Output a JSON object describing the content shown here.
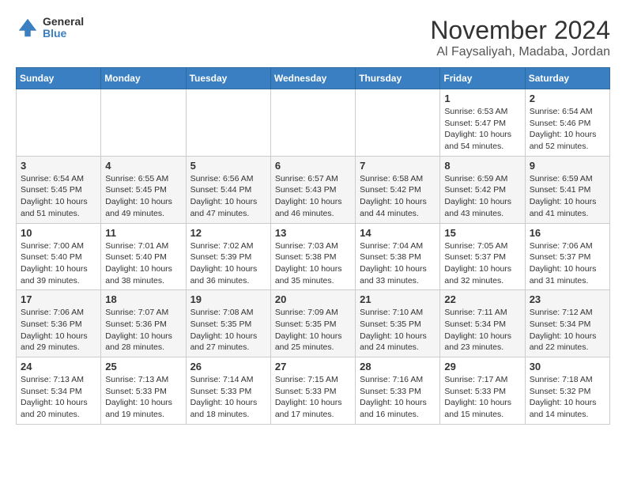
{
  "logo": {
    "general": "General",
    "blue": "Blue"
  },
  "header": {
    "month": "November 2024",
    "location": "Al Faysaliyah, Madaba, Jordan"
  },
  "days_of_week": [
    "Sunday",
    "Monday",
    "Tuesday",
    "Wednesday",
    "Thursday",
    "Friday",
    "Saturday"
  ],
  "weeks": [
    [
      {
        "day": "",
        "info": ""
      },
      {
        "day": "",
        "info": ""
      },
      {
        "day": "",
        "info": ""
      },
      {
        "day": "",
        "info": ""
      },
      {
        "day": "",
        "info": ""
      },
      {
        "day": "1",
        "info": "Sunrise: 6:53 AM\nSunset: 5:47 PM\nDaylight: 10 hours and 54 minutes."
      },
      {
        "day": "2",
        "info": "Sunrise: 6:54 AM\nSunset: 5:46 PM\nDaylight: 10 hours and 52 minutes."
      }
    ],
    [
      {
        "day": "3",
        "info": "Sunrise: 6:54 AM\nSunset: 5:45 PM\nDaylight: 10 hours and 51 minutes."
      },
      {
        "day": "4",
        "info": "Sunrise: 6:55 AM\nSunset: 5:45 PM\nDaylight: 10 hours and 49 minutes."
      },
      {
        "day": "5",
        "info": "Sunrise: 6:56 AM\nSunset: 5:44 PM\nDaylight: 10 hours and 47 minutes."
      },
      {
        "day": "6",
        "info": "Sunrise: 6:57 AM\nSunset: 5:43 PM\nDaylight: 10 hours and 46 minutes."
      },
      {
        "day": "7",
        "info": "Sunrise: 6:58 AM\nSunset: 5:42 PM\nDaylight: 10 hours and 44 minutes."
      },
      {
        "day": "8",
        "info": "Sunrise: 6:59 AM\nSunset: 5:42 PM\nDaylight: 10 hours and 43 minutes."
      },
      {
        "day": "9",
        "info": "Sunrise: 6:59 AM\nSunset: 5:41 PM\nDaylight: 10 hours and 41 minutes."
      }
    ],
    [
      {
        "day": "10",
        "info": "Sunrise: 7:00 AM\nSunset: 5:40 PM\nDaylight: 10 hours and 39 minutes."
      },
      {
        "day": "11",
        "info": "Sunrise: 7:01 AM\nSunset: 5:40 PM\nDaylight: 10 hours and 38 minutes."
      },
      {
        "day": "12",
        "info": "Sunrise: 7:02 AM\nSunset: 5:39 PM\nDaylight: 10 hours and 36 minutes."
      },
      {
        "day": "13",
        "info": "Sunrise: 7:03 AM\nSunset: 5:38 PM\nDaylight: 10 hours and 35 minutes."
      },
      {
        "day": "14",
        "info": "Sunrise: 7:04 AM\nSunset: 5:38 PM\nDaylight: 10 hours and 33 minutes."
      },
      {
        "day": "15",
        "info": "Sunrise: 7:05 AM\nSunset: 5:37 PM\nDaylight: 10 hours and 32 minutes."
      },
      {
        "day": "16",
        "info": "Sunrise: 7:06 AM\nSunset: 5:37 PM\nDaylight: 10 hours and 31 minutes."
      }
    ],
    [
      {
        "day": "17",
        "info": "Sunrise: 7:06 AM\nSunset: 5:36 PM\nDaylight: 10 hours and 29 minutes."
      },
      {
        "day": "18",
        "info": "Sunrise: 7:07 AM\nSunset: 5:36 PM\nDaylight: 10 hours and 28 minutes."
      },
      {
        "day": "19",
        "info": "Sunrise: 7:08 AM\nSunset: 5:35 PM\nDaylight: 10 hours and 27 minutes."
      },
      {
        "day": "20",
        "info": "Sunrise: 7:09 AM\nSunset: 5:35 PM\nDaylight: 10 hours and 25 minutes."
      },
      {
        "day": "21",
        "info": "Sunrise: 7:10 AM\nSunset: 5:35 PM\nDaylight: 10 hours and 24 minutes."
      },
      {
        "day": "22",
        "info": "Sunrise: 7:11 AM\nSunset: 5:34 PM\nDaylight: 10 hours and 23 minutes."
      },
      {
        "day": "23",
        "info": "Sunrise: 7:12 AM\nSunset: 5:34 PM\nDaylight: 10 hours and 22 minutes."
      }
    ],
    [
      {
        "day": "24",
        "info": "Sunrise: 7:13 AM\nSunset: 5:34 PM\nDaylight: 10 hours and 20 minutes."
      },
      {
        "day": "25",
        "info": "Sunrise: 7:13 AM\nSunset: 5:33 PM\nDaylight: 10 hours and 19 minutes."
      },
      {
        "day": "26",
        "info": "Sunrise: 7:14 AM\nSunset: 5:33 PM\nDaylight: 10 hours and 18 minutes."
      },
      {
        "day": "27",
        "info": "Sunrise: 7:15 AM\nSunset: 5:33 PM\nDaylight: 10 hours and 17 minutes."
      },
      {
        "day": "28",
        "info": "Sunrise: 7:16 AM\nSunset: 5:33 PM\nDaylight: 10 hours and 16 minutes."
      },
      {
        "day": "29",
        "info": "Sunrise: 7:17 AM\nSunset: 5:33 PM\nDaylight: 10 hours and 15 minutes."
      },
      {
        "day": "30",
        "info": "Sunrise: 7:18 AM\nSunset: 5:32 PM\nDaylight: 10 hours and 14 minutes."
      }
    ]
  ]
}
